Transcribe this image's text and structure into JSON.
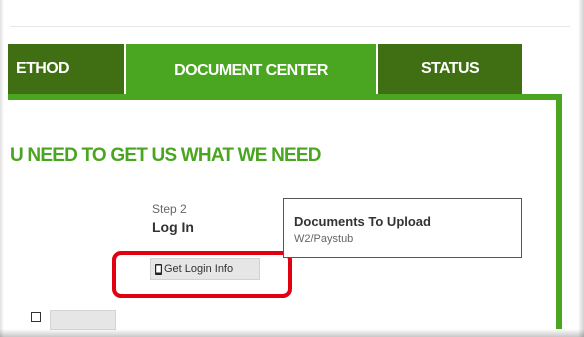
{
  "tabs": [
    {
      "label": "ETHOD",
      "active": false
    },
    {
      "label": "DOCUMENT CENTER",
      "active": true
    },
    {
      "label": "STATUS",
      "active": false
    }
  ],
  "heading": "U NEED TO GET US WHAT WE NEED",
  "step": {
    "number": "Step 2",
    "title": "Log In"
  },
  "login_button": {
    "label": "Get Login Info",
    "icon": "phone-icon"
  },
  "documents": {
    "title": "Documents To Upload",
    "subtitle": "W2/Paystub"
  },
  "colors": {
    "tab_active": "#4aa520",
    "tab_inactive": "#3f6f12",
    "heading": "#4aa520",
    "highlight": "#e0000f"
  }
}
